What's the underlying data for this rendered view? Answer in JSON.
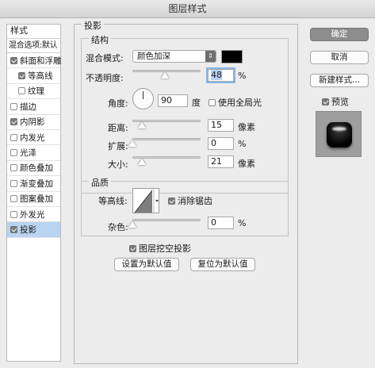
{
  "window": {
    "title": "图层样式"
  },
  "styles_list": {
    "header": "样式",
    "blend_options": "混合选项:默认",
    "items": [
      {
        "label": "斜面和浮雕",
        "checked": true,
        "sub": false,
        "selected": false
      },
      {
        "label": "等高线",
        "checked": true,
        "sub": true,
        "selected": false
      },
      {
        "label": "纹理",
        "checked": false,
        "sub": true,
        "selected": false
      },
      {
        "label": "描边",
        "checked": false,
        "sub": false,
        "selected": false
      },
      {
        "label": "内阴影",
        "checked": true,
        "sub": false,
        "selected": false
      },
      {
        "label": "内发光",
        "checked": false,
        "sub": false,
        "selected": false
      },
      {
        "label": "光泽",
        "checked": false,
        "sub": false,
        "selected": false
      },
      {
        "label": "颜色叠加",
        "checked": false,
        "sub": false,
        "selected": false
      },
      {
        "label": "渐变叠加",
        "checked": false,
        "sub": false,
        "selected": false
      },
      {
        "label": "图案叠加",
        "checked": false,
        "sub": false,
        "selected": false
      },
      {
        "label": "外发光",
        "checked": false,
        "sub": false,
        "selected": false
      },
      {
        "label": "投影",
        "checked": true,
        "sub": false,
        "selected": true
      }
    ]
  },
  "drop_shadow": {
    "title": "投影",
    "structure": {
      "title": "结构",
      "blend_mode_label": "混合模式:",
      "blend_mode_value": "颜色加深",
      "shadow_color": "#000000",
      "opacity_label": "不透明度:",
      "opacity_value": "48",
      "opacity_unit": "%",
      "opacity_level": 0.48,
      "angle_label": "角度:",
      "angle_value": "90",
      "angle_unit": "度",
      "global_light_label": "使用全局光",
      "global_light_checked": false,
      "distance_label": "距离:",
      "distance_value": "15",
      "distance_unit": "像素",
      "spread_label": "扩展:",
      "spread_value": "0",
      "spread_unit": "%",
      "size_label": "大小:",
      "size_value": "21",
      "size_unit": "像素"
    },
    "quality": {
      "title": "品质",
      "contour_label": "等高线:",
      "anti_alias_label": "消除锯齿",
      "anti_alias_checked": true,
      "noise_label": "杂色:",
      "noise_value": "0",
      "noise_unit": "%"
    },
    "knockout_label": "图层挖空投影",
    "knockout_checked": true,
    "make_default_label": "设置为默认值",
    "reset_default_label": "复位为默认值"
  },
  "actions": {
    "ok_label": "确定",
    "cancel_label": "取消",
    "new_style_label": "新建样式...",
    "preview_label": "预览",
    "preview_checked": true
  }
}
